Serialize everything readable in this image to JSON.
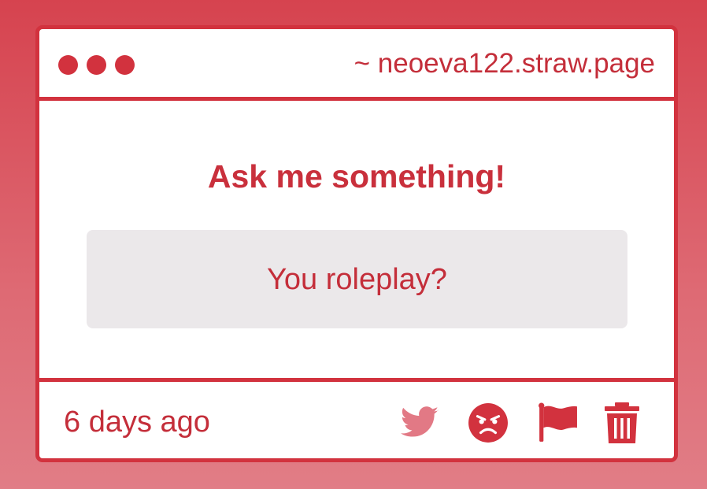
{
  "window": {
    "url": "~ neoeva122.straw.page"
  },
  "main": {
    "heading": "Ask me something!",
    "question": "You roleplay?"
  },
  "footer": {
    "timestamp": "6 days ago",
    "actions": [
      {
        "icon": "twitter-icon"
      },
      {
        "icon": "angry-face-icon"
      },
      {
        "icon": "flag-icon"
      },
      {
        "icon": "trash-icon"
      }
    ]
  },
  "colors": {
    "accent": "#d2323e",
    "text": "#c42e3a",
    "question_bg": "#ebe8ea",
    "twitter_icon": "#e27985"
  }
}
